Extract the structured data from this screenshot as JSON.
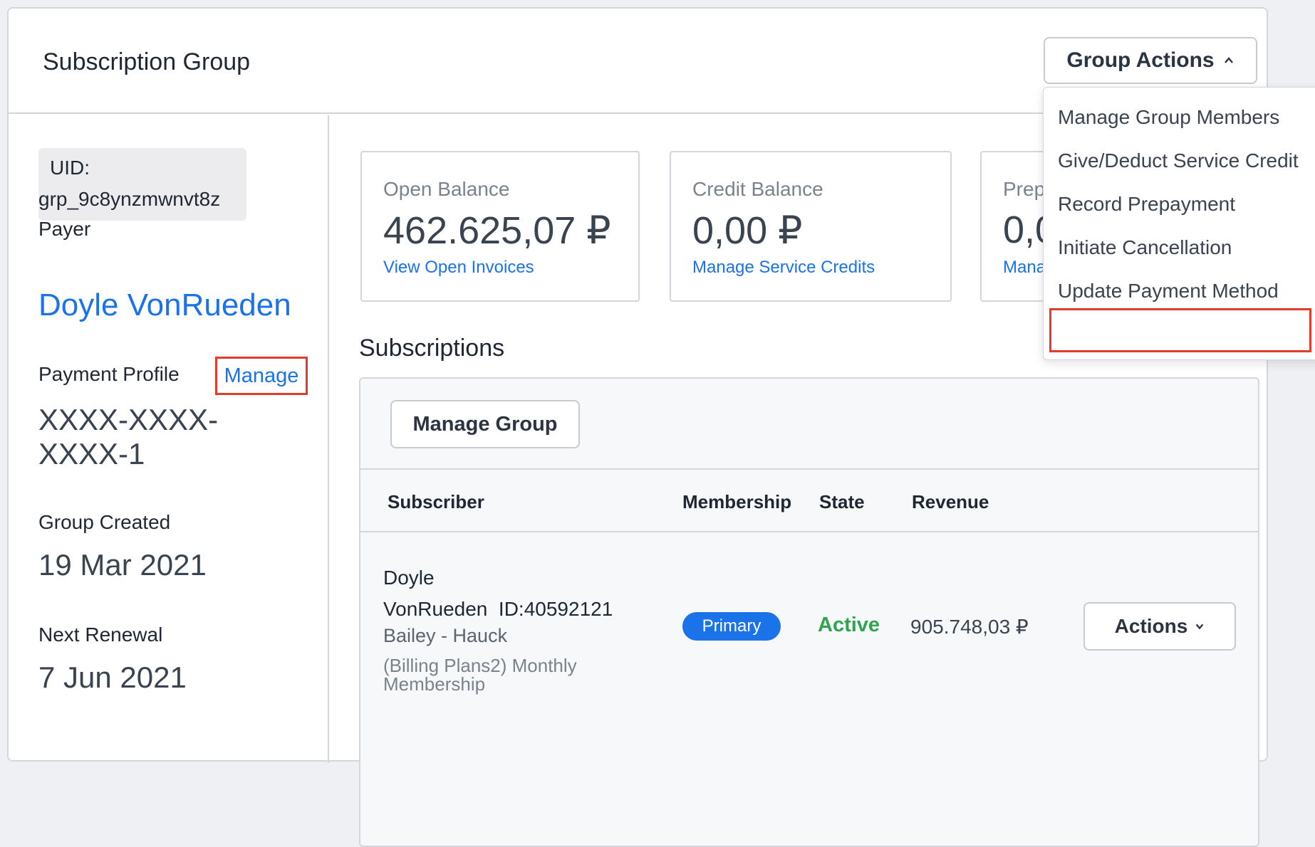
{
  "header": {
    "title": "Subscription Group",
    "group_actions_label": "Group Actions"
  },
  "group_actions_menu": {
    "items": [
      "Manage Group Members",
      "Give/Deduct Service Credit",
      "Record Prepayment",
      "Initiate Cancellation",
      "Update Payment Method"
    ]
  },
  "sidebar": {
    "uid_label": "UID:",
    "uid_value": "grp_9c8ynzmwnvt8z",
    "payer_label": "Payer",
    "payer_name": "Doyle VonRueden",
    "payment_profile_label": "Payment Profile",
    "manage_link": "Manage",
    "card_number": "XXXX-XXXX-XXXX-1",
    "group_created_label": "Group Created",
    "group_created_value": "19 Mar 2021",
    "next_renewal_label": "Next Renewal",
    "next_renewal_value": "7 Jun 2021"
  },
  "stats": [
    {
      "label": "Open Balance",
      "value": "462.625,07 ₽",
      "link": "View Open Invoices"
    },
    {
      "label": "Credit Balance",
      "value": "0,00 ₽",
      "link": "Manage Service Credits"
    },
    {
      "label": "Prep",
      "value": "0,0",
      "link": "Mana"
    }
  ],
  "subscriptions": {
    "title": "Subscriptions",
    "manage_group_label": "Manage Group",
    "columns": [
      "Subscriber",
      "Membership",
      "State",
      "Revenue"
    ],
    "rows": [
      {
        "subscriber": "Doyle VonRueden",
        "id": "ID:40592121",
        "company": "Bailey - Hauck",
        "plan": "(Billing Plans2) Monthly Membership",
        "membership": "Primary",
        "state": "Active",
        "revenue": "905.748,03 ₽",
        "actions_label": "Actions"
      }
    ]
  },
  "colors": {
    "link": "#1a73e8",
    "active": "#2ea44f",
    "highlight": "#e23b2a"
  }
}
